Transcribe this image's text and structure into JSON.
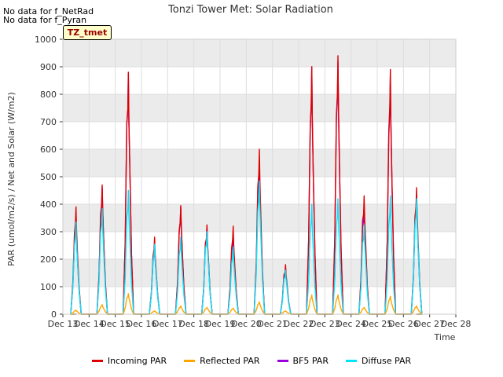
{
  "notes": [
    "No data for f_NetRad",
    "No data for f_Pyran"
  ],
  "badge": "TZ_tmet",
  "chart_data": {
    "type": "line",
    "title": "Tonzi Tower Met: Solar Radiation",
    "xlabel": "Time",
    "ylabel": "PAR (umol/m2/s) / Net and Solar (W/m2)",
    "ylim": [
      0,
      1000
    ],
    "yticks": [
      0,
      100,
      200,
      300,
      400,
      500,
      600,
      700,
      800,
      900,
      1000
    ],
    "xlim": [
      13,
      28
    ],
    "xtick_labels": [
      "Dec 13",
      "Dec 14",
      "Dec 15",
      "Dec 16",
      "Dec 17",
      "Dec 18",
      "Dec 19",
      "Dec 20",
      "Dec 21",
      "Dec 22",
      "Dec 23",
      "Dec 24",
      "Dec 25",
      "Dec 26",
      "Dec 27",
      "Dec 28"
    ],
    "grid": true,
    "legend_position": "bottom",
    "series": [
      {
        "name": "Incoming PAR",
        "color": "#dd0000",
        "peaks": [
          [
            13.5,
            390
          ],
          [
            14.5,
            470
          ],
          [
            15.5,
            880
          ],
          [
            16.5,
            280
          ],
          [
            17.5,
            395
          ],
          [
            18.5,
            325
          ],
          [
            19.5,
            320
          ],
          [
            20.5,
            600
          ],
          [
            21.5,
            180
          ],
          [
            22.5,
            900
          ],
          [
            23.5,
            940
          ],
          [
            24.5,
            430
          ],
          [
            25.5,
            890
          ],
          [
            26.5,
            460
          ]
        ]
      },
      {
        "name": "Reflected PAR",
        "color": "#ffa500",
        "peaks": [
          [
            13.5,
            15
          ],
          [
            14.5,
            35
          ],
          [
            15.5,
            75
          ],
          [
            16.5,
            12
          ],
          [
            17.5,
            30
          ],
          [
            18.5,
            25
          ],
          [
            19.5,
            22
          ],
          [
            20.5,
            45
          ],
          [
            21.5,
            12
          ],
          [
            22.5,
            70
          ],
          [
            23.5,
            70
          ],
          [
            24.5,
            25
          ],
          [
            25.5,
            65
          ],
          [
            26.5,
            30
          ]
        ]
      },
      {
        "name": "BF5 PAR",
        "color": "#9900dd",
        "peaks": [
          [
            13.5,
            340
          ],
          [
            14.5,
            460
          ],
          [
            15.5,
            875
          ],
          [
            16.5,
            255
          ],
          [
            17.5,
            390
          ],
          [
            18.5,
            320
          ],
          [
            19.5,
            300
          ],
          [
            20.5,
            560
          ],
          [
            21.5,
            170
          ],
          [
            22.5,
            900
          ],
          [
            23.5,
            920
          ],
          [
            24.5,
            400
          ],
          [
            25.5,
            870
          ],
          [
            26.5,
            430
          ]
        ]
      },
      {
        "name": "Diffuse PAR",
        "color": "#00e5ff",
        "peaks": [
          [
            13.5,
            335
          ],
          [
            14.5,
            385
          ],
          [
            15.5,
            450
          ],
          [
            16.5,
            255
          ],
          [
            17.5,
            280
          ],
          [
            18.5,
            300
          ],
          [
            19.5,
            245
          ],
          [
            20.5,
            485
          ],
          [
            21.5,
            160
          ],
          [
            22.5,
            400
          ],
          [
            23.5,
            420
          ],
          [
            24.5,
            325
          ],
          [
            25.5,
            430
          ],
          [
            26.5,
            420
          ]
        ]
      }
    ]
  }
}
